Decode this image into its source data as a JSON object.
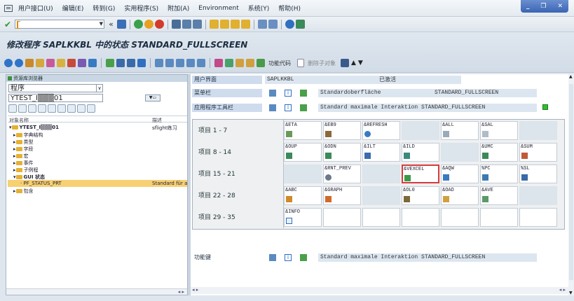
{
  "menubar": {
    "items": [
      "用户接口(U)",
      "编辑(E)",
      "转到(G)",
      "实用程序(S)",
      "附加(A)",
      "Environment",
      "系统(Y)",
      "帮助(H)"
    ],
    "window_controls": [
      "_",
      "❐",
      "✕"
    ]
  },
  "toolbar": {
    "command_field_value": ""
  },
  "title": {
    "text": "修改程序 SAPLKKBL 中的状态 STANDARD_FULLSCREEN"
  },
  "app_toolbar": {
    "function_code_label": "功能代码",
    "delete_object_label": "删除子对象"
  },
  "left": {
    "header": "资源库浏览器",
    "object_type": "程序",
    "object_name": "YTEST_I▒▒▒01",
    "columns": {
      "name": "对象名称",
      "desc": "描述"
    },
    "tree": [
      {
        "label": "YTEST_I▒▒▒01",
        "desc": "sflight练习",
        "indent": 1
      },
      {
        "label": "字典结构",
        "desc": "",
        "indent": 2
      },
      {
        "label": "类型",
        "desc": "",
        "indent": 2
      },
      {
        "label": "字段",
        "desc": "",
        "indent": 2
      },
      {
        "label": "宏",
        "desc": "",
        "indent": 2
      },
      {
        "label": "事件",
        "desc": "",
        "indent": 2
      },
      {
        "label": "子例程",
        "desc": "",
        "indent": 2
      },
      {
        "label": "GUI 状态",
        "desc": "",
        "indent": 2
      },
      {
        "label": "PF_STATUS_PRT",
        "desc": "Standard für all",
        "indent": 3
      },
      {
        "label": "包含",
        "desc": "",
        "indent": 2
      }
    ]
  },
  "right": {
    "ui_label": "用户界面",
    "program": "SAPLKKBL",
    "status": "已激活",
    "menubar_label": "菜单栏",
    "menubar_text": "Standardoberfläche",
    "menubar_status": "STANDARD_FULLSCREEN",
    "app_toolbar_label": "应用程序工具栏",
    "app_toolbar_text": "Standard maximale Interaktion STANDARD_FULLSCREEN",
    "fkeys_label": "功能键",
    "fkeys_text": "Standard maximale Interaktion STANDARD_FULLSCREEN",
    "grid": [
      {
        "label": "项目  1 - 7",
        "cells": [
          "&ETA",
          "&EB9",
          "&REFRESH",
          "",
          "&ALL",
          "&SAL",
          ""
        ]
      },
      {
        "label": "项目  8 - 14",
        "cells": [
          "&OUP",
          "&ODN",
          "&ILT",
          "&ILD",
          "",
          "&UMC",
          "&SUM"
        ]
      },
      {
        "label": "项目 15 - 21",
        "cells": [
          "",
          "&RNT_PREV",
          "",
          "&VEXCEL",
          "&AQW",
          "%PC",
          "%SL"
        ]
      },
      {
        "label": "项目 22 - 28",
        "cells": [
          "&ABC",
          "&GRAPH",
          "",
          "&OL0",
          "&OAD",
          "&AVE",
          ""
        ]
      },
      {
        "label": "项目 29 - 35",
        "cells": [
          "&INFO",
          "",
          "",
          "",
          "",
          "",
          ""
        ]
      }
    ],
    "highlighted_cell": "&VEXCEL"
  },
  "colors": {
    "highlight": "#d93a3a",
    "selected_row": "#f7d074",
    "title_bg": "#d2dce7"
  }
}
